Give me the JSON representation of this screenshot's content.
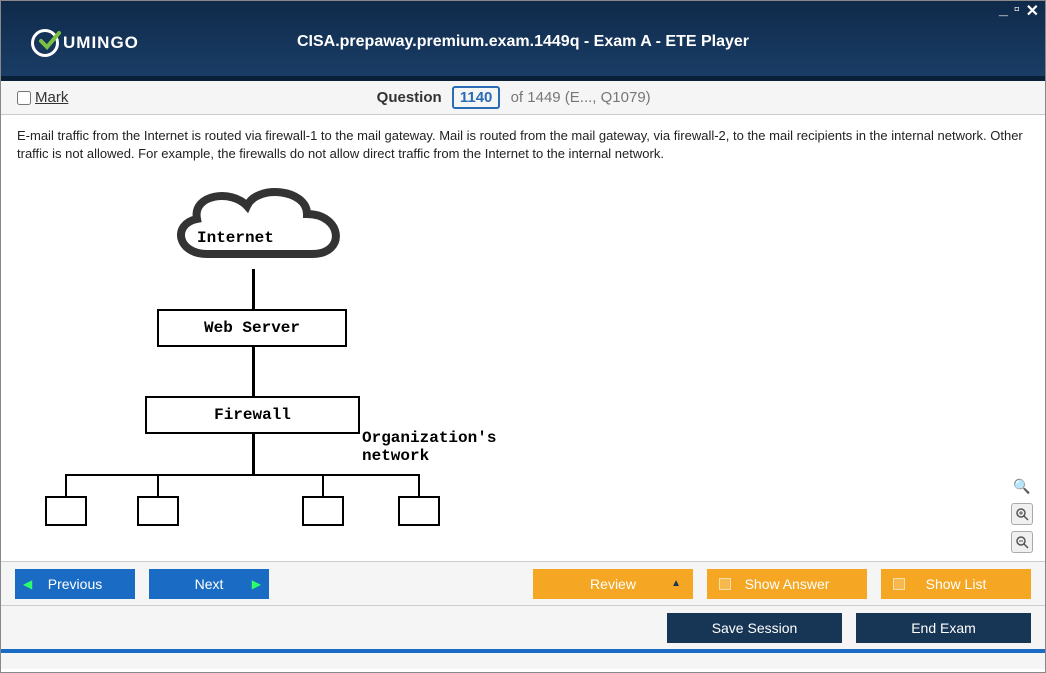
{
  "window": {
    "title": "CISA.prepaway.premium.exam.1449q - Exam A - ETE Player",
    "logo_text": "UMINGO"
  },
  "header": {
    "mark_label": "Mark",
    "question_label": "Question",
    "question_number": "1140",
    "of_total": "of 1449 (E..., Q1079)"
  },
  "question": {
    "text": "E-mail traffic from the Internet is routed via firewall-1 to the mail gateway. Mail is routed from the mail gateway, via firewall-2, to the mail recipients in the internal network. Other traffic is not allowed. For example, the firewalls do not allow direct traffic from the Internet to the internal network."
  },
  "diagram": {
    "internet": "Internet",
    "web_server": "Web Server",
    "firewall": "Firewall",
    "org_network": "Organization's network"
  },
  "buttons": {
    "previous": "Previous",
    "next": "Next",
    "review": "Review",
    "show_answer": "Show Answer",
    "show_list": "Show List",
    "save_session": "Save Session",
    "end_exam": "End Exam"
  }
}
